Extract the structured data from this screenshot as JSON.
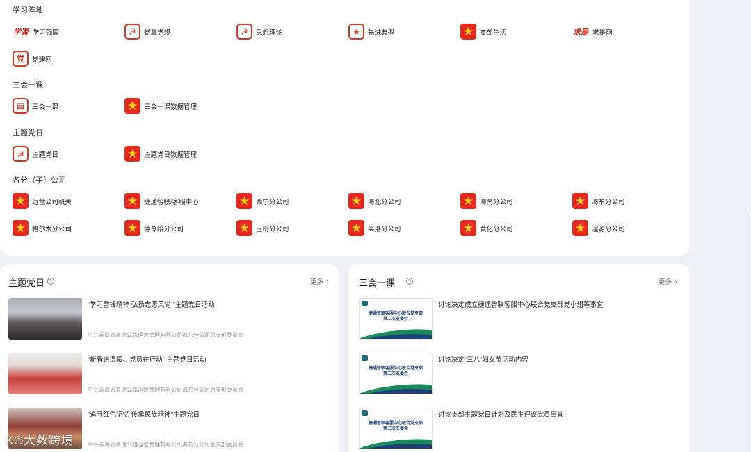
{
  "sections": [
    {
      "title": "学习阵地",
      "rows": [
        [
          {
            "label": "学习强国",
            "icon": "xuexi-qiangguo-logo-icon",
            "style": "calli",
            "glyph": "学習"
          },
          {
            "label": "党章党规",
            "icon": "party-emblem-icon",
            "style": "frame",
            "glyph": "☭"
          },
          {
            "label": "思想理论",
            "icon": "party-emblem-icon",
            "style": "frame",
            "glyph": "☭"
          },
          {
            "label": "先进典型",
            "icon": "star-frame-icon",
            "style": "frame",
            "glyph": "★"
          },
          {
            "label": "支部生活",
            "icon": "star-icon",
            "style": "star",
            "glyph": "★"
          },
          {
            "label": "求是网",
            "icon": "qiushi-logo-icon",
            "style": "calli",
            "glyph": "求是"
          }
        ],
        [
          {
            "label": "党建网",
            "icon": "dangjian-icon",
            "style": "frame",
            "glyph": "党"
          }
        ]
      ]
    },
    {
      "title": "三会一课",
      "rows": [
        [
          {
            "label": "三会一课",
            "icon": "document-icon",
            "style": "frame",
            "glyph": "▤"
          },
          {
            "label": "三会一课数据管理",
            "icon": "star-icon",
            "style": "star",
            "glyph": "★"
          }
        ]
      ]
    },
    {
      "title": "主题党日",
      "rows": [
        [
          {
            "label": "主题党日",
            "icon": "party-emblem-icon",
            "style": "frame",
            "glyph": "☭"
          },
          {
            "label": "主题党日数据管理",
            "icon": "star-icon",
            "style": "star",
            "glyph": "★"
          }
        ]
      ]
    },
    {
      "title": "各分（子）公司",
      "rows": [
        [
          {
            "label": "运营公司机关",
            "icon": "star-icon",
            "style": "star",
            "glyph": "★"
          },
          {
            "label": "捷通智联/客服中心",
            "icon": "star-icon",
            "style": "star",
            "glyph": "★"
          },
          {
            "label": "西宁分公司",
            "icon": "star-icon",
            "style": "star",
            "glyph": "★"
          },
          {
            "label": "海北分公司",
            "icon": "star-icon",
            "style": "star",
            "glyph": "★"
          },
          {
            "label": "海南分公司",
            "icon": "star-icon",
            "style": "star",
            "glyph": "★"
          },
          {
            "label": "海东分公司",
            "icon": "star-icon",
            "style": "star",
            "glyph": "★"
          }
        ],
        [
          {
            "label": "格尔木分公司",
            "icon": "star-icon",
            "style": "star",
            "glyph": "★"
          },
          {
            "label": "德令哈分公司",
            "icon": "star-icon",
            "style": "star",
            "glyph": "★"
          },
          {
            "label": "玉树分公司",
            "icon": "star-icon",
            "style": "star",
            "glyph": "★"
          },
          {
            "label": "果洛分公司",
            "icon": "star-icon",
            "style": "star",
            "glyph": "★"
          },
          {
            "label": "黄化分公司",
            "icon": "star-icon",
            "style": "star",
            "glyph": "★"
          },
          {
            "label": "湟源分公司",
            "icon": "star-icon",
            "style": "star",
            "glyph": "★"
          }
        ]
      ]
    }
  ],
  "left_panel": {
    "title": "主题党日",
    "more": "更多",
    "items": [
      {
        "title": "“学习雷锋精神 弘扬志愿风尚 ”主题党日活动",
        "source": "中共青海省高速公路运营管理有限公司海东分公司总支部委员会"
      },
      {
        "title": "“新春送温暖、党员在行动” 主题党日活动",
        "source": "中共青海省高速公路运营管理有限公司海东分公司总支部委员会"
      },
      {
        "title": "“追寻红色记忆 传承民族精神”主题党日",
        "source": "中共青海省高速公路运营管理有限公司海东分公司总支部委员会"
      }
    ]
  },
  "right_panel": {
    "title": "三会一课",
    "more": "更多",
    "slide": {
      "line1": "捷通智联客服中心联合党支部",
      "line2": "第二次支委会"
    },
    "items": [
      {
        "title": "讨论决定成立捷通智联客服中心联合党支部党小组等事宜"
      },
      {
        "title": "讨论决定“三八”妇女节活动内容"
      },
      {
        "title": "讨论支部主题党日计划及民主评议党员事宜"
      }
    ]
  },
  "watermark": "K©大数跨境"
}
